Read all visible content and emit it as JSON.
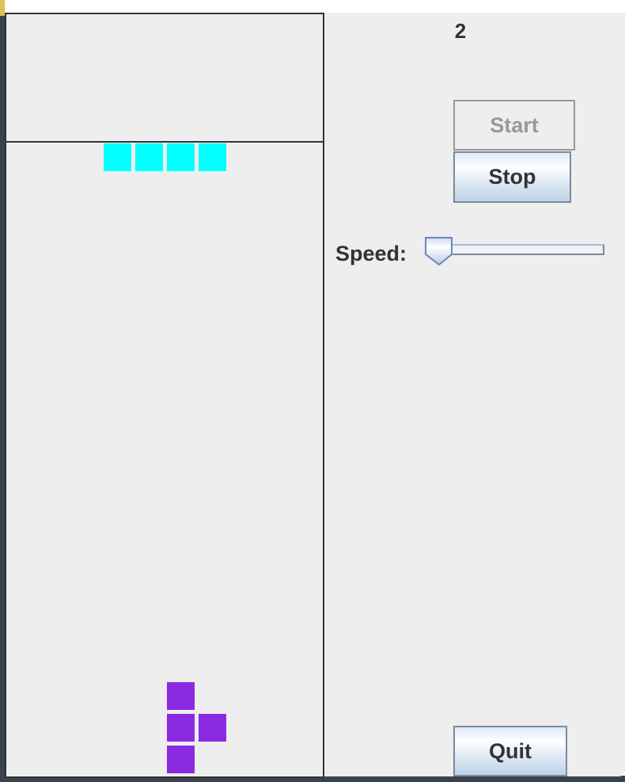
{
  "score": "2",
  "buttons": {
    "start": "Start",
    "stop": "Stop",
    "quit": "Quit"
  },
  "speed": {
    "label": "Speed:",
    "value_fraction": 0.0
  },
  "colors": {
    "i_piece": "#00ffff",
    "t_piece": "#8a2be2",
    "background": "#eeeeee"
  },
  "board": {
    "falling_piece": {
      "type": "I",
      "color": "#00ffff"
    },
    "landed_piece": {
      "type": "T",
      "color": "#8a2be2"
    }
  }
}
